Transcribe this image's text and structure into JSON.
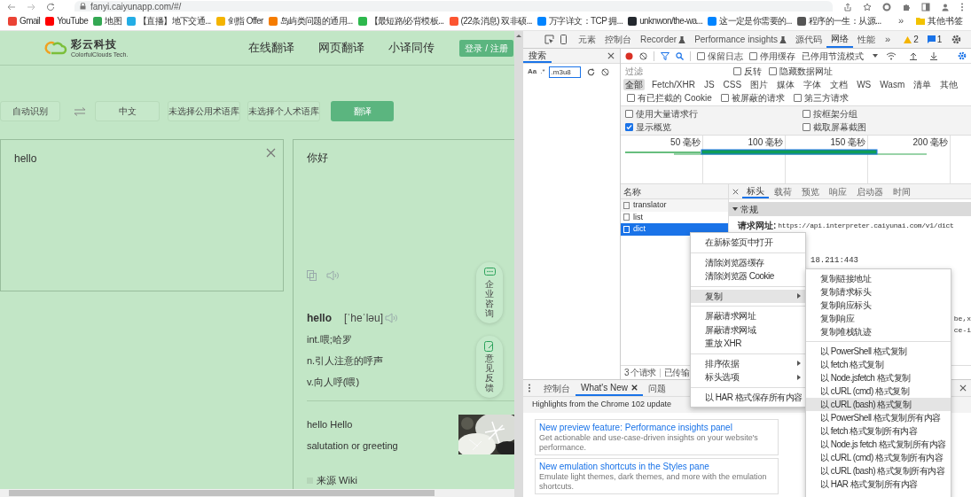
{
  "browser": {
    "url": "fanyi.caiyunapp.com/#/",
    "bookmarks": [
      {
        "label": "Gmail",
        "color": "#ea4335"
      },
      {
        "label": "YouTube",
        "color": "#ff0000"
      },
      {
        "label": "地图",
        "color": "#34a853"
      },
      {
        "label": "【直播】地下交通...",
        "color": "#23ade5"
      },
      {
        "label": "剑指 Offer",
        "color": "#f4b400"
      },
      {
        "label": "岛屿类问题的通用...",
        "color": "#f57c00"
      },
      {
        "label": "【最短路/必背模板...",
        "color": "#2db84d"
      },
      {
        "label": "(22条消息) 双非硕...",
        "color": "#fc5531"
      },
      {
        "label": "万字详文：TCP 拥...",
        "color": "#0084ff"
      },
      {
        "label": "unknwon/the-wa...",
        "color": "#24292f"
      },
      {
        "label": "这一定是你需要的...",
        "color": "#0084ff"
      },
      {
        "label": "程序的一生：从源...",
        "color": "#555555"
      }
    ],
    "more": "»",
    "other_bookmarks": "其他书签"
  },
  "site": {
    "logo_name": "彩云科技",
    "logo_tagline": "ColorfulClouds Tech.",
    "nav": [
      "在线翻译",
      "网页翻译",
      "小译同传"
    ],
    "login": "登录 / 注册"
  },
  "translator": {
    "source_lang": "自动识别",
    "target_lang": "中文",
    "public_glossary": "未选择公用术语库",
    "private_glossary": "未选择个人术语库",
    "translate_button": "翻译",
    "input": "hello",
    "output": "你好",
    "word": "hello",
    "phonetic": "[ˈheˈləu]",
    "definitions": [
      "int.喂;哈罗",
      "n.引人注意的呼声",
      "v.向人呼(喂)"
    ],
    "example_title": "hello Hello",
    "example_text": "salutation or greeting",
    "source": "来源 Wiki",
    "side_buttons": [
      "企业咨询",
      "意见反馈"
    ]
  },
  "devtools": {
    "tabs": [
      {
        "label": "元素",
        "selected": false,
        "experimental": false
      },
      {
        "label": "控制台",
        "selected": false,
        "experimental": false
      },
      {
        "label": "Recorder",
        "selected": false,
        "experimental": true
      },
      {
        "label": "Performance insights",
        "selected": false,
        "experimental": true
      },
      {
        "label": "源代码",
        "selected": false,
        "experimental": false
      },
      {
        "label": "网络",
        "selected": true,
        "experimental": false
      },
      {
        "label": "性能",
        "selected": false,
        "experimental": false
      }
    ],
    "more_tabs": "»",
    "warnings": "2",
    "messages": "1",
    "search_panel": {
      "tabs": [
        {
          "label": "搜索",
          "selected": true
        }
      ],
      "case_label": "Aa",
      "regex_label": ".*",
      "query": ".m3u8"
    },
    "network": {
      "options": [
        {
          "label": "保留日志",
          "checked": false
        },
        {
          "label": "停用缓存",
          "checked": false
        }
      ],
      "throttle": "已停用节流模式",
      "filter_placeholder": "过滤",
      "filter_options": [
        {
          "label": "反转",
          "checked": false
        },
        {
          "label": "隐藏数据网址",
          "checked": false
        }
      ],
      "types": [
        {
          "label": "全部",
          "selected": true
        },
        {
          "label": "Fetch/XHR",
          "selected": false
        },
        {
          "label": "JS",
          "selected": false
        },
        {
          "label": "CSS",
          "selected": false
        },
        {
          "label": "图片",
          "selected": false
        },
        {
          "label": "媒体",
          "selected": false
        },
        {
          "label": "字体",
          "selected": false
        },
        {
          "label": "文档",
          "selected": false
        },
        {
          "label": "WS",
          "selected": false
        },
        {
          "label": "Wasm",
          "selected": false
        },
        {
          "label": "清单",
          "selected": false
        },
        {
          "label": "其他",
          "selected": false
        }
      ],
      "request_filters": [
        {
          "label": "有已拦截的 Cookie",
          "checked": false
        },
        {
          "label": "被屏蔽的请求",
          "checked": false
        },
        {
          "label": "第三方请求",
          "checked": false
        }
      ],
      "settings": [
        {
          "label": "使用大量请求行",
          "checked": false
        },
        {
          "label": "按框架分组",
          "checked": false
        },
        {
          "label": "显示概览",
          "checked": true
        },
        {
          "label": "截取屏幕截图",
          "checked": false
        }
      ],
      "overview_ticks": [
        "50 毫秒",
        "100 毫秒",
        "150 毫秒",
        "200 毫秒"
      ],
      "name_header": "名称",
      "requests": [
        {
          "name": "translator",
          "selected": false
        },
        {
          "name": "list",
          "selected": false
        },
        {
          "name": "dict",
          "selected": true
        }
      ],
      "detail_tabs": [
        {
          "label": "标头",
          "selected": true
        },
        {
          "label": "载荷",
          "selected": false
        },
        {
          "label": "预览",
          "selected": false
        },
        {
          "label": "响应",
          "selected": false
        },
        {
          "label": "启动器",
          "selected": false
        },
        {
          "label": "时间",
          "selected": false
        }
      ],
      "section": "常规",
      "request_url_label": "请求网址:",
      "request_url": "https://api.interpreter.caiyunai.com/v1/dict",
      "remote_fragment": "18.211:443",
      "right_fragments": [
        "be,x",
        "ce-i"
      ],
      "summary": [
        "3 个请求",
        "已传输"
      ]
    },
    "drawer": {
      "tabs": [
        {
          "label": "控制台",
          "selected": false,
          "closable": false
        },
        {
          "label": "What's New",
          "selected": true,
          "closable": true
        },
        {
          "label": "问题",
          "selected": false,
          "closable": false
        }
      ],
      "title": "Highlights from the Chrome 102 update",
      "cards": [
        {
          "title": "New preview feature: Performance insights panel",
          "text": "Get actionable and use-case-driven insights on your website's performance."
        },
        {
          "title": "New emulation shortcuts in the Styles pane",
          "text": "Emulate light themes, dark themes, and more with the emulation shortcuts."
        }
      ]
    }
  },
  "context_menu": {
    "groups": [
      [
        {
          "label": "在新标签页中打开",
          "submenu": false,
          "highlighted": false
        }
      ],
      [
        {
          "label": "清除浏览器缓存",
          "submenu": false,
          "highlighted": false
        },
        {
          "label": "清除浏览器 Cookie",
          "submenu": false,
          "highlighted": false
        }
      ],
      [
        {
          "label": "复制",
          "submenu": true,
          "highlighted": true
        }
      ],
      [
        {
          "label": "屏蔽请求网址",
          "submenu": false,
          "highlighted": false
        },
        {
          "label": "屏蔽请求网域",
          "submenu": false,
          "highlighted": false
        },
        {
          "label": "重放 XHR",
          "submenu": false,
          "highlighted": false
        }
      ],
      [
        {
          "label": "排序依据",
          "submenu": true,
          "highlighted": false
        },
        {
          "label": "标头选项",
          "submenu": true,
          "highlighted": false
        }
      ],
      [
        {
          "label": "以 HAR 格式保存所有内容",
          "submenu": false,
          "highlighted": false
        }
      ]
    ]
  },
  "submenu": {
    "groups": [
      [
        {
          "label": "复制链接地址",
          "highlighted": false
        },
        {
          "label": "复制请求标头",
          "highlighted": false
        },
        {
          "label": "复制响应标头",
          "highlighted": false
        },
        {
          "label": "复制响应",
          "highlighted": false
        },
        {
          "label": "复制堆栈轨迹",
          "highlighted": false
        }
      ],
      [
        {
          "label": "以 PowerShell 格式复制",
          "highlighted": false
        },
        {
          "label": "以 fetch 格式复制",
          "highlighted": false
        },
        {
          "label": "以 Node.jsfetch 格式复制",
          "highlighted": false
        },
        {
          "label": "以 cURL (cmd) 格式复制",
          "highlighted": false
        },
        {
          "label": "以 cURL (bash) 格式复制",
          "highlighted": true
        },
        {
          "label": "以 PowerShell 格式复制所有内容",
          "highlighted": false
        },
        {
          "label": "以 fetch 格式复制所有内容",
          "highlighted": false
        },
        {
          "label": "以 Node.js fetch 格式复制所有内容",
          "highlighted": false
        },
        {
          "label": "以 cURL (cmd) 格式复制所有内容",
          "highlighted": false
        },
        {
          "label": "以 cURL (bash) 格式复制所有内容",
          "highlighted": false
        },
        {
          "label": "以 HAR 格式复制所有内容",
          "highlighted": false
        }
      ]
    ]
  }
}
